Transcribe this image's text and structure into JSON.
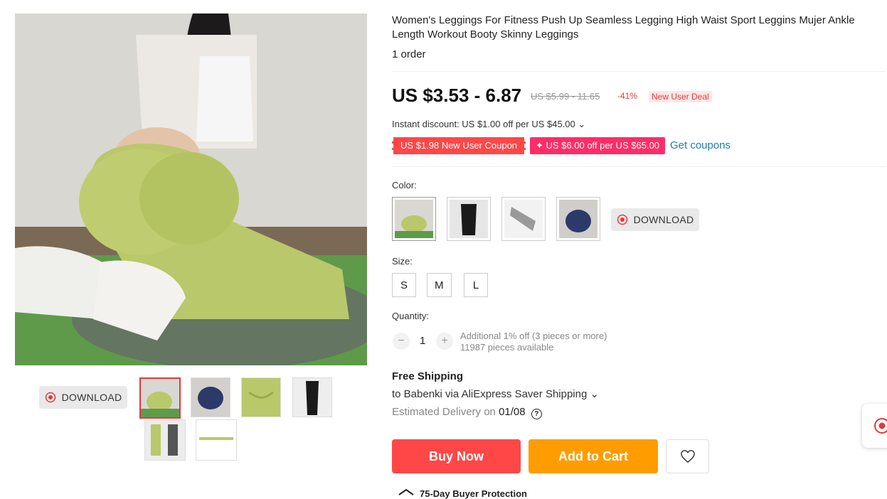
{
  "product": {
    "title": "Women's Leggings For Fitness Push Up Seamless Legging High Waist Sport Leggins Mujer Ankle Length Workout Booty Skinny Leggings",
    "orders": "1 order",
    "price": "US $3.53 - 6.87",
    "original_price": "US $5.99 - 11.65",
    "discount_pct": "-41%",
    "deal_tag": "New User Deal",
    "instant_discount": "Instant discount: US $1.00 off per US $45.00 ⌄",
    "coupon_new_user": "US $1.98 New User Coupon",
    "coupon_store": "✦ US $6.00 off per US $65.00",
    "get_coupons": "Get coupons"
  },
  "gallery": {
    "download_label": "DOWNLOAD",
    "thumb_count": 6
  },
  "options": {
    "color_label": "Color:",
    "color_download_label": "DOWNLOAD",
    "size_label": "Size:",
    "sizes": [
      "S",
      "M",
      "L"
    ],
    "quantity_label": "Quantity:",
    "quantity_value": "1",
    "qty_minus": "−",
    "qty_plus": "+",
    "qty_note_1": "Additional 1% off (3 pieces or more)",
    "qty_note_2": "11987 pieces available"
  },
  "shipping": {
    "title": "Free Shipping",
    "line": "to Babenki via AliExpress Saver Shipping ⌄",
    "est_prefix": "Estimated Delivery on ",
    "est_date": "01/08",
    "help_icon": "?"
  },
  "actions": {
    "buy_now": "Buy Now",
    "add_to_cart": "Add to Cart",
    "protection": "75-Day Buyer Protection"
  },
  "colors": {
    "accent_red": "#ff4747",
    "cart_orange": "#ff9c00",
    "coupon_pink": "#ff2d67",
    "link_blue": "#1f7ea8",
    "legging_green": "#b9c86a"
  }
}
